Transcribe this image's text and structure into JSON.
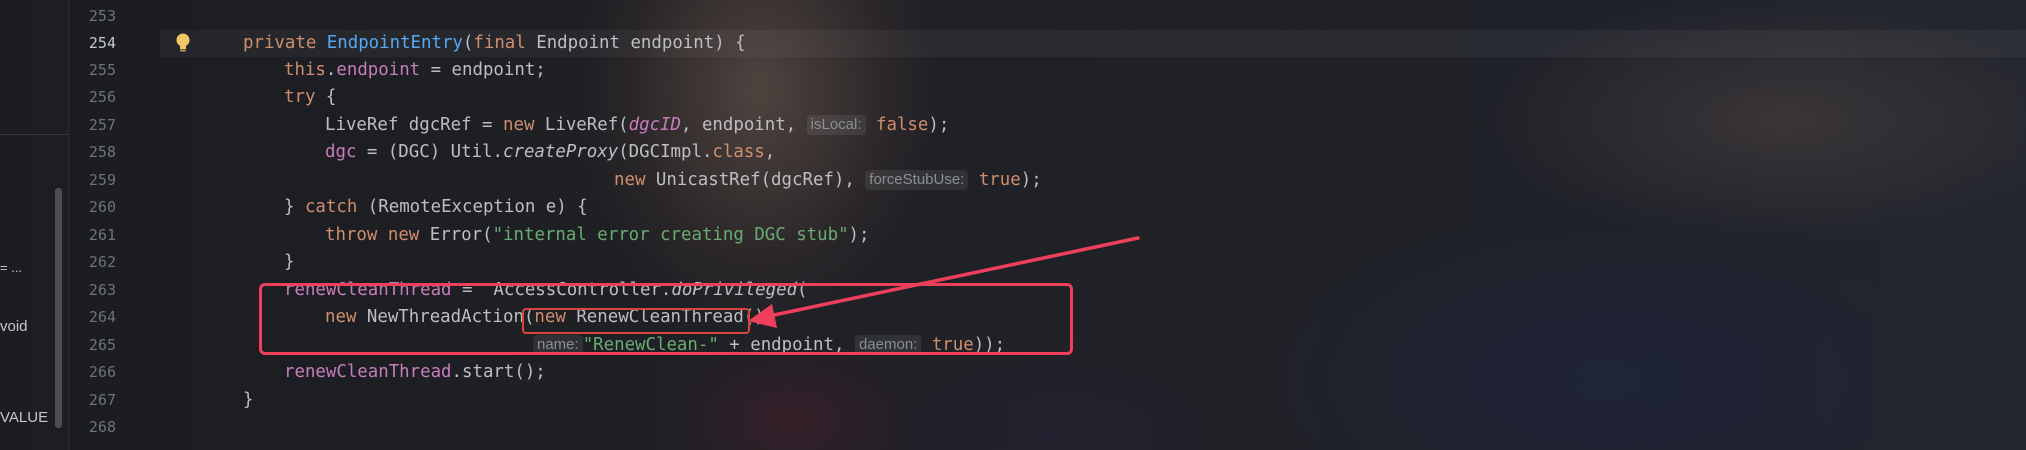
{
  "side_panel": {
    "items": [
      {
        "text": "= ..."
      },
      {
        "text": "void"
      },
      {
        "text": "VALUE"
      }
    ]
  },
  "gutter": {
    "line_numbers": [
      "253",
      "254",
      "255",
      "256",
      "257",
      "258",
      "259",
      "260",
      "261",
      "262",
      "263",
      "264",
      "265",
      "266",
      "267",
      "268"
    ],
    "current_line": "254",
    "bulb_icon": "lightbulb-icon"
  },
  "code": {
    "l254": {
      "kw_private": "private",
      "fn": "EndpointEntry",
      "p1": "(",
      "kw_final": "final",
      "p2": " Endpoint endpoint) {"
    },
    "l255": {
      "kw_this": "this",
      "dot": ".",
      "fld": "endpoint",
      "rest": " = endpoint;"
    },
    "l256": {
      "kw_try": "try",
      "rest": " {"
    },
    "l257": {
      "a": "LiveRef dgcRef = ",
      "kw_new": "new",
      "b": " LiveRef(",
      "fld": "dgcID",
      "c": ", endpoint, ",
      "hint": "isLocal:",
      "kw_false": "false",
      "d": ");"
    },
    "l258": {
      "fld": "dgc",
      "a": " = (DGC) Util.",
      "call": "createProxy",
      "b": "(DGCImpl.",
      "kw_class": "class",
      "c": ","
    },
    "l259": {
      "kw_new": "new",
      "a": " UnicastRef(dgcRef), ",
      "hint": "forceStubUse:",
      "kw_true": "true",
      "b": ");"
    },
    "l260": {
      "a": "} ",
      "kw_catch": "catch",
      "b": " (RemoteException e) {"
    },
    "l261": {
      "kw_throw": "throw",
      "sp": " ",
      "kw_new": "new",
      "a": " Error(",
      "str": "\"internal error creating DGC stub\"",
      "b": ");"
    },
    "l262": {
      "a": "}"
    },
    "l263": {
      "fld": "renewCleanThread",
      "a": " =  AccessController.",
      "call": "doPrivileged",
      "b": "("
    },
    "l264": {
      "kw_new": "new",
      "a": " NewThreadAction(",
      "kw_new2": "new",
      "b": " RenewCleanThread()"
    },
    "l265": {
      "hint": "name:",
      "str": "\"RenewClean-\"",
      "a": " + endpoint, ",
      "hint2": "daemon:",
      "kw_true": "true",
      "b": "));"
    },
    "l266": {
      "fld": "renewCleanThread",
      "a": ".start();"
    },
    "l267": {
      "a": "}"
    }
  },
  "colors": {
    "keyword": "#cf8e6d",
    "function": "#56a8f5",
    "field": "#c77dbb",
    "string": "#6aab73",
    "plain": "#bcbec4",
    "annotation": "#ef3f5d"
  }
}
